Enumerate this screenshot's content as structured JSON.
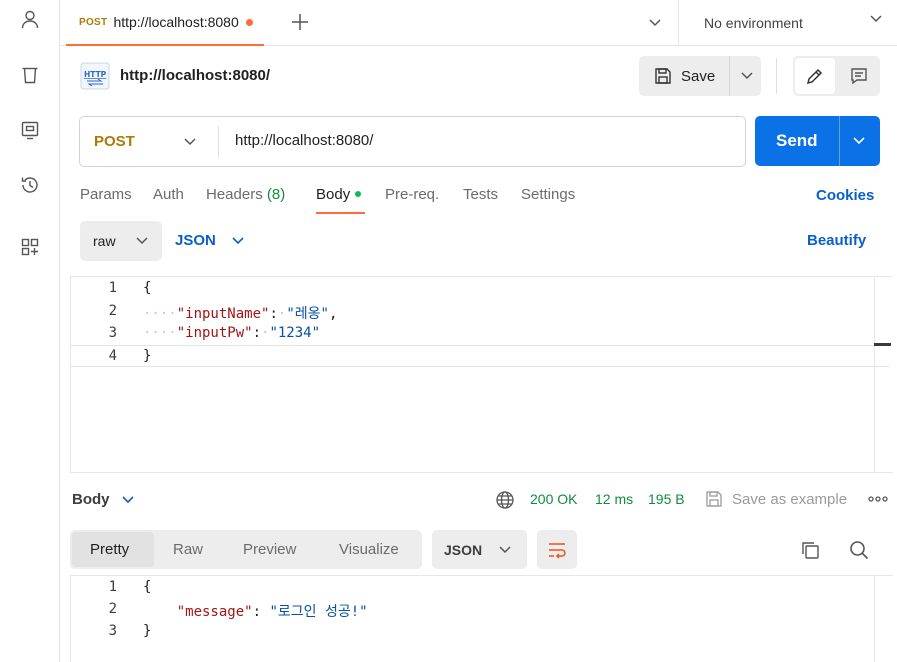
{
  "tab": {
    "method": "POST",
    "url": "http://localhost:8080"
  },
  "environment": {
    "selected": "No environment"
  },
  "request": {
    "title": "http://localhost:8080/",
    "method": "POST",
    "url": "http://localhost:8080/",
    "save_label": "Save",
    "send_label": "Send"
  },
  "request_tabs": {
    "params": "Params",
    "auth": "Auth",
    "headers": "Headers",
    "headers_count": "(8)",
    "body": "Body",
    "prereq": "Pre-req.",
    "tests": "Tests",
    "settings": "Settings",
    "cookies": "Cookies"
  },
  "body_options": {
    "mode": "raw",
    "language": "JSON",
    "beautify": "Beautify"
  },
  "request_body_lines": [
    {
      "n": "1",
      "open": "{"
    },
    {
      "n": "2",
      "key": "\"inputName\"",
      "colon": ":",
      "value": "\"레옹\"",
      "comma": ","
    },
    {
      "n": "3",
      "key": "\"inputPw\"",
      "colon": ":",
      "value": "\"1234\""
    },
    {
      "n": "4",
      "close": "}"
    }
  ],
  "response": {
    "section": "Body",
    "status": "200 OK",
    "time": "12 ms",
    "size": "195 B",
    "save_example": "Save as example",
    "view_tabs": [
      "Pretty",
      "Raw",
      "Preview",
      "Visualize"
    ],
    "language": "JSON",
    "lines": [
      {
        "n": "1",
        "open": "{"
      },
      {
        "n": "2",
        "key": "\"message\"",
        "colon": ":",
        "value": "\"로그인 성공!\""
      },
      {
        "n": "3",
        "close": "}"
      }
    ]
  },
  "colors": {
    "accent": "#ff6c37",
    "post_method": "#ad7a03",
    "send": "#0b71e6",
    "link": "#0b5fcc",
    "status_ok": "#0f8d3c"
  },
  "icons": {
    "rail": [
      "user-icon",
      "trash-icon",
      "monitor-icon",
      "history-icon",
      "grid-add-icon"
    ],
    "toolbar": [
      "save-icon",
      "pencil-icon",
      "comment-icon"
    ],
    "response": [
      "globe-icon",
      "save-example-icon",
      "more-icon",
      "wrap-icon",
      "copy-icon",
      "search-icon"
    ]
  }
}
